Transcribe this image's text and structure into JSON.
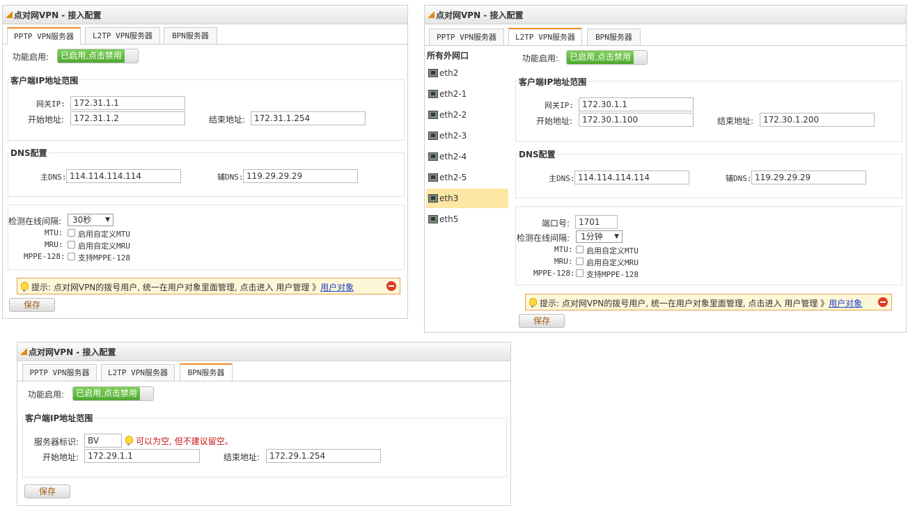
{
  "panel_title": "点对网VPN - 接入配置",
  "tabs": [
    "PPTP VPN服务器",
    "L2TP VPN服务器",
    "BPN服务器"
  ],
  "common": {
    "enable_label": "功能启用:",
    "enabled_toggle": "已启用,点击禁用",
    "client_range_title": "客户端IP地址范围",
    "gateway_label": "网关IP:",
    "start_label": "开始地址:",
    "end_label": "结束地址:",
    "dns_title": "DNS配置",
    "primary_dns_label": "主DNS:",
    "secondary_dns_label": "辅DNS:",
    "interval_label": "检测在线间隔:",
    "mtu_label": "MTU:",
    "mtu_text": "启用自定义MTU",
    "mru_label": "MRU:",
    "mru_text": "启用自定义MRU",
    "mppe_label": "MPPE-128:",
    "mppe_text": "支持MPPE-128",
    "tip_text": "提示: 点对网VPN的拨号用户, 统一在用户对象里面管理, 点击进入 用户管理 》",
    "tip_link": "用户对象",
    "save": "保存"
  },
  "pptp": {
    "gateway": "172.31.1.1",
    "start": "172.31.1.2",
    "end": "172.31.1.254",
    "primary_dns": "114.114.114.114",
    "secondary_dns": "119.29.29.29",
    "interval": "30秒"
  },
  "l2tp": {
    "interfaces_title": "所有外网口",
    "interfaces": [
      "eth2",
      "eth2-1",
      "eth2-2",
      "eth2-3",
      "eth2-4",
      "eth2-5",
      "eth3",
      "eth5"
    ],
    "selected_interface": "eth3",
    "gateway": "172.30.1.1",
    "start": "172.30.1.100",
    "end": "172.30.1.200",
    "primary_dns": "114.114.114.114",
    "secondary_dns": "119.29.29.29",
    "port_label": "端口号:",
    "port": "1701",
    "interval": "1分钟"
  },
  "bpn": {
    "server_id_label": "服务器标识:",
    "server_id": "BV",
    "server_id_hint": "可以为空, 但不建议留空。",
    "start": "172.29.1.1",
    "end": "172.29.1.254"
  }
}
